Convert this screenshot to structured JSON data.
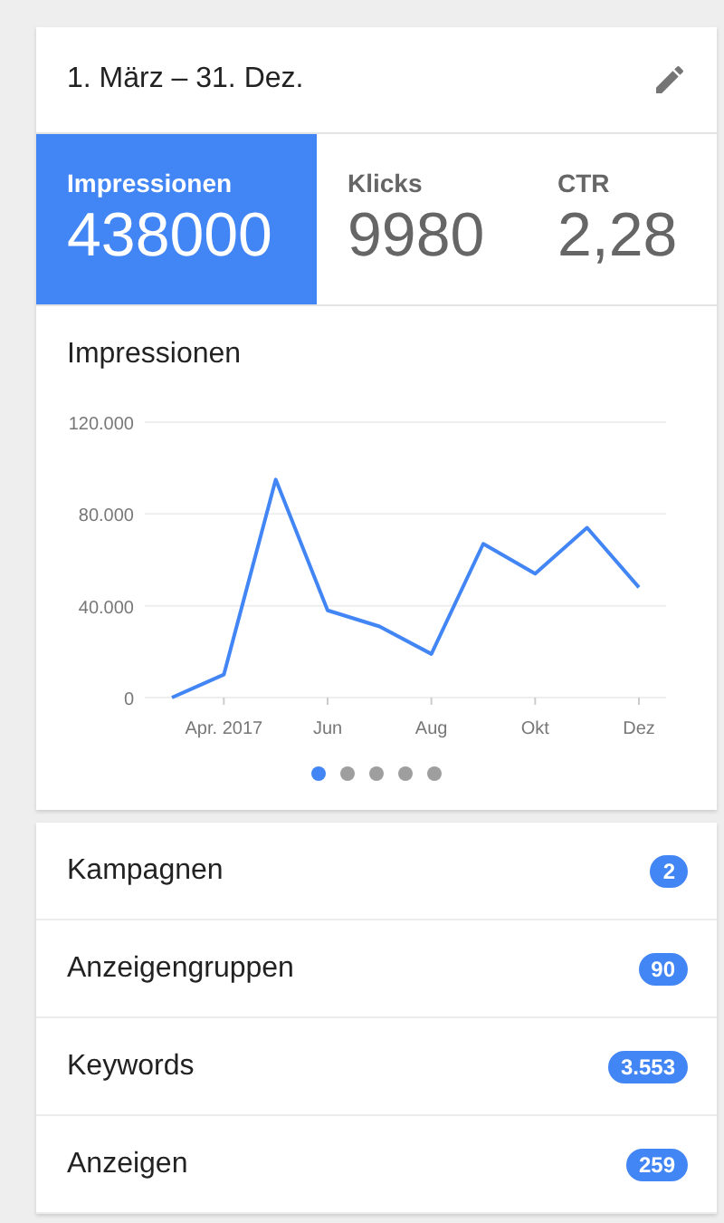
{
  "header": {
    "date_range": "1. März – 31. Dez."
  },
  "metrics": [
    {
      "label": "Impressionen",
      "value": "438000",
      "selected": true
    },
    {
      "label": "Klicks",
      "value": "9980",
      "selected": false
    },
    {
      "label": "CTR",
      "value": "2,28",
      "selected": false
    }
  ],
  "chart": {
    "title": "Impressionen",
    "chart_data": {
      "type": "line",
      "categories": [
        null,
        "Apr. 2017",
        null,
        "Jun",
        null,
        "Aug",
        null,
        "Okt",
        null,
        "Dez"
      ],
      "series": [
        {
          "color": "#4285f4",
          "values": [
            0,
            10000,
            95000,
            38000,
            31000,
            19000,
            67000,
            54000,
            74000,
            48000
          ]
        }
      ],
      "ylim": [
        0,
        120000
      ],
      "yticks": [
        {
          "value": 0,
          "label": "0"
        },
        {
          "value": 40000,
          "label": "40.000"
        },
        {
          "value": 80000,
          "label": "80.000"
        },
        {
          "value": 120000,
          "label": "120.000"
        }
      ]
    }
  },
  "pager": [
    {
      "selected": true
    },
    {
      "selected": false
    },
    {
      "selected": false
    },
    {
      "selected": false
    },
    {
      "selected": false
    }
  ],
  "summary": [
    {
      "label": "Kampagnen",
      "count": "2"
    },
    {
      "label": "Anzeigengruppen",
      "count": "90"
    },
    {
      "label": "Keywords",
      "count": "3.553"
    },
    {
      "label": "Anzeigen",
      "count": "259"
    }
  ]
}
